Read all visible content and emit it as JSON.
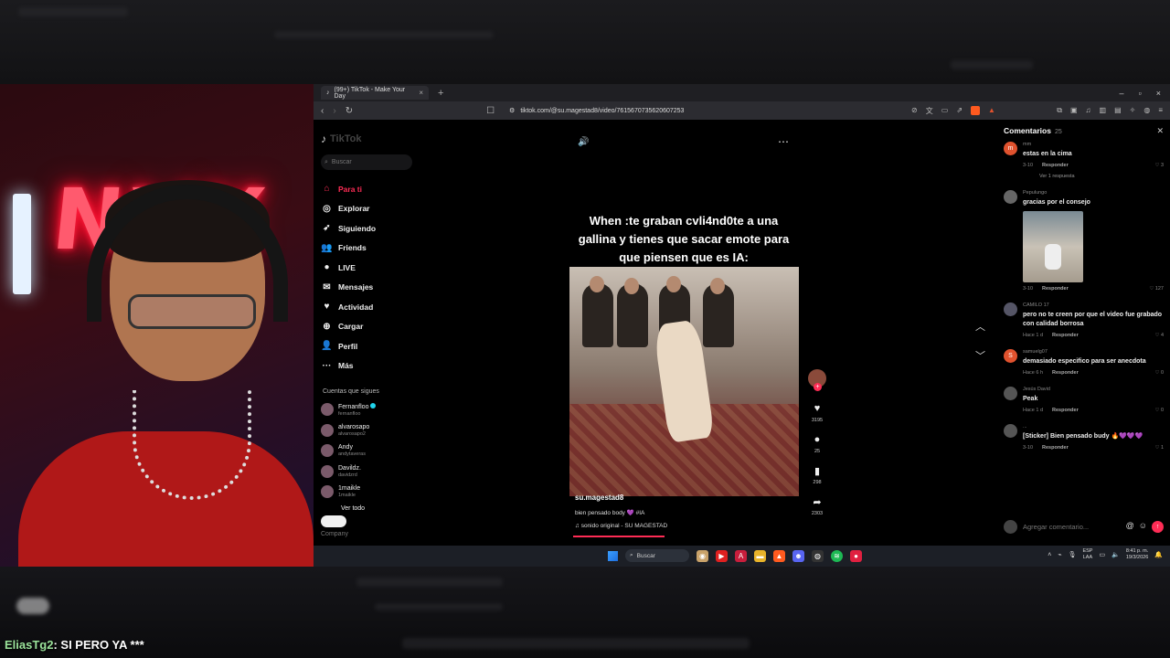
{
  "browser": {
    "tab_title": "(99+) TikTok - Make Your Day",
    "url": "tiktok.com/@su.magestad8/video/7615670735620607253"
  },
  "tiktok": {
    "logo": "TikTok",
    "search_placeholder": "Buscar",
    "nav": [
      {
        "label": "Para ti",
        "icon": "home-icon",
        "glyph": "⌂"
      },
      {
        "label": "Explorar",
        "icon": "compass-icon",
        "glyph": "◎"
      },
      {
        "label": "Siguiendo",
        "icon": "following-icon",
        "glyph": "➶"
      },
      {
        "label": "Friends",
        "icon": "friends-icon",
        "glyph": "👥"
      },
      {
        "label": "LIVE",
        "icon": "live-icon",
        "glyph": "●"
      },
      {
        "label": "Mensajes",
        "icon": "messages-icon",
        "glyph": "✉"
      },
      {
        "label": "Actividad",
        "icon": "activity-icon",
        "glyph": "♥"
      },
      {
        "label": "Cargar",
        "icon": "upload-icon",
        "glyph": "⊕"
      },
      {
        "label": "Perfil",
        "icon": "profile-icon",
        "glyph": "👤"
      },
      {
        "label": "Más",
        "icon": "more-icon",
        "glyph": "···"
      }
    ],
    "following_title": "Cuentas que sigues",
    "following": [
      {
        "name": "Fernanfloo",
        "handle": "fernanfloo"
      },
      {
        "name": "alvarosapo",
        "handle": "alvarosapo2"
      },
      {
        "name": "Andy",
        "handle": "andytaveras"
      },
      {
        "name": "Davildz.",
        "handle": "davidzrd"
      },
      {
        "name": "1maikle",
        "handle": "1maikle"
      }
    ],
    "see_all": "Ver todo",
    "company": "Company"
  },
  "video": {
    "caption_overlay": "When :te graban cvli4nd0te  a una gallina y tienes que sacar emote para que piensen que es IA:",
    "username": "su.magestad8",
    "description": "bien pensado body 💜 #IA",
    "sound": "sonido original - SU MAGESTAD",
    "likes": "3195",
    "comments": "25",
    "saves": "298",
    "shares": "2303"
  },
  "comments_panel": {
    "title": "Comentarios",
    "count": "25",
    "items": [
      {
        "user": "mm",
        "text": "estas en la cima",
        "time": "3-10",
        "reply": "Responder",
        "likes": "3",
        "avatar_letter": "m",
        "color": "#e0522e"
      },
      {
        "user": "Pepulungo",
        "text": "gracias por el consejo",
        "time": "3-10",
        "reply": "Responder",
        "likes": "127",
        "avatar_letter": "",
        "color": "#666"
      },
      {
        "user": "CAMILO 17",
        "text": "pero no te creen por que el video fue grabado con calidad borrosa",
        "time": "Hace 1 d",
        "reply": "Responder",
        "likes": "4",
        "avatar_letter": "",
        "color": "#556"
      },
      {
        "user": "samuelg07",
        "text": "demasiado especifico para ser anecdota",
        "time": "Hace 6 h",
        "reply": "Responder",
        "likes": "0",
        "avatar_letter": "S",
        "color": "#e0522e"
      },
      {
        "user": "Jesús David",
        "text": "Peak",
        "time": "Hace 1 d",
        "reply": "Responder",
        "likes": "0",
        "avatar_letter": "",
        "color": "#555"
      },
      {
        "user": "...",
        "text": "[Sticker] Bien pensado budy 🔥💜💜💜",
        "time": "3-10",
        "reply": "Responder",
        "likes": "1",
        "avatar_letter": "",
        "color": "#555"
      }
    ],
    "see_replies": "Ver 1 respuesta",
    "input_placeholder": "Agregar comentario..."
  },
  "taskbar": {
    "search": "Buscar",
    "lang_top": "ESP",
    "lang_bottom": "LAA",
    "time": "8:41 p. m.",
    "date": "19/3/2026"
  },
  "chat": {
    "user": "EliasTg2",
    "message": ": SI PERO YA ***"
  },
  "webcam": {
    "neon_text": "NVX"
  },
  "colors": {
    "accent": "#fe2c55",
    "background": "#000000"
  }
}
